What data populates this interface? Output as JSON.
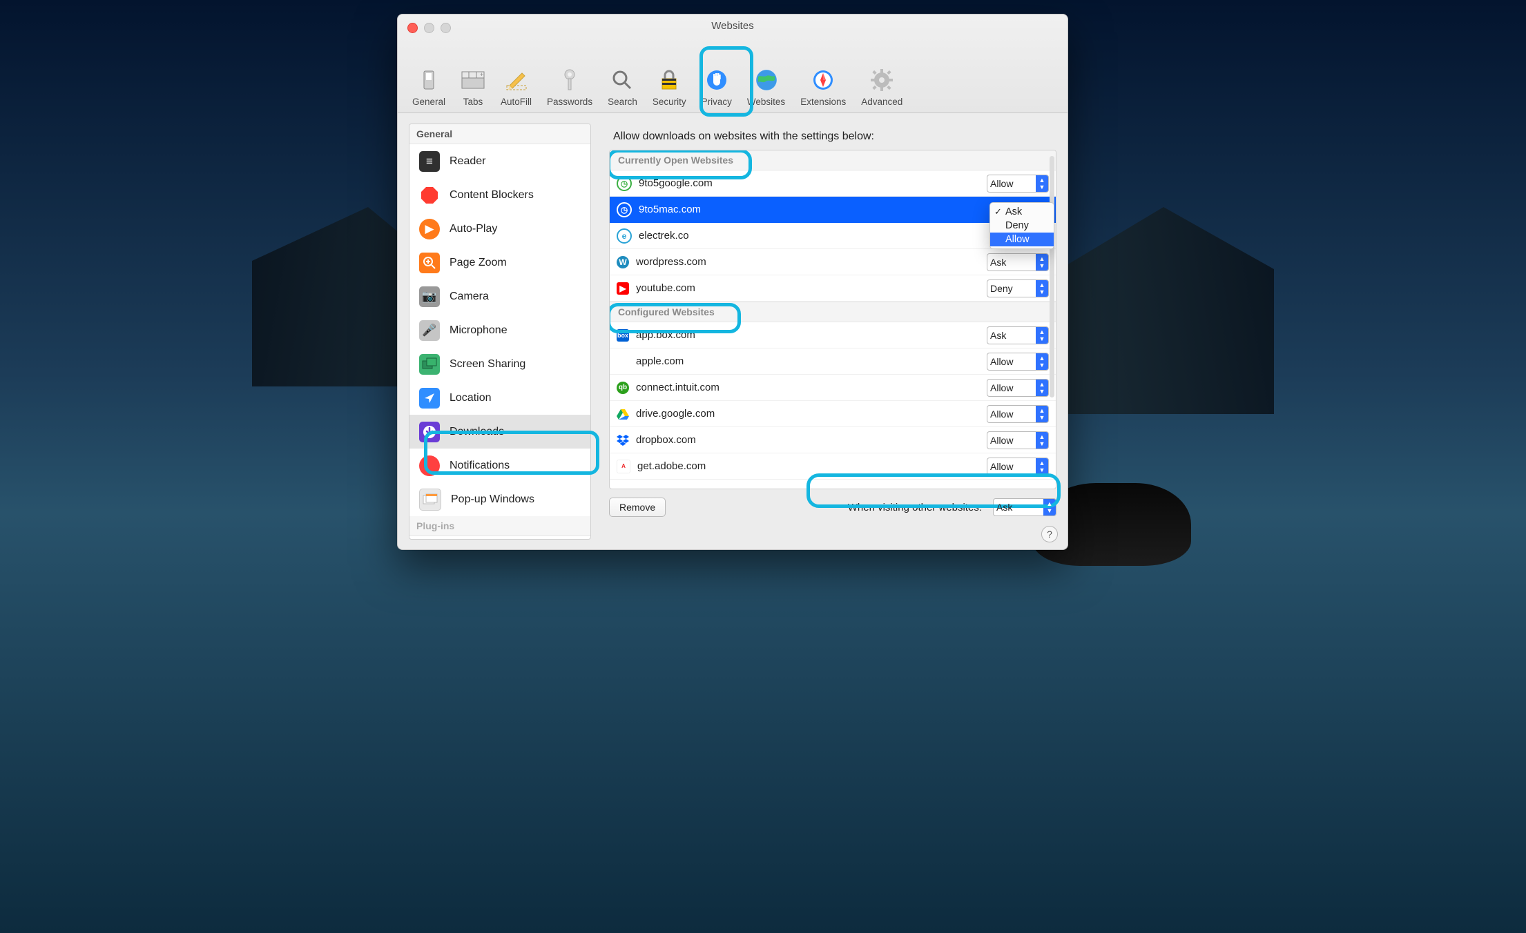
{
  "window": {
    "title": "Websites"
  },
  "toolbar": {
    "items": [
      {
        "label": "General"
      },
      {
        "label": "Tabs"
      },
      {
        "label": "AutoFill"
      },
      {
        "label": "Passwords"
      },
      {
        "label": "Search"
      },
      {
        "label": "Security"
      },
      {
        "label": "Privacy"
      },
      {
        "label": "Websites"
      },
      {
        "label": "Extensions"
      },
      {
        "label": "Advanced"
      }
    ],
    "active_index": 7
  },
  "sidebar": {
    "sections": [
      {
        "title": "General",
        "items": [
          {
            "label": "Reader",
            "icon": "reader"
          },
          {
            "label": "Content Blockers",
            "icon": "block"
          },
          {
            "label": "Auto-Play",
            "icon": "play"
          },
          {
            "label": "Page Zoom",
            "icon": "zoom"
          },
          {
            "label": "Camera",
            "icon": "cam"
          },
          {
            "label": "Microphone",
            "icon": "mic"
          },
          {
            "label": "Screen Sharing",
            "icon": "screen"
          },
          {
            "label": "Location",
            "icon": "loc"
          },
          {
            "label": "Downloads",
            "icon": "dl"
          },
          {
            "label": "Notifications",
            "icon": "notif"
          },
          {
            "label": "Pop-up Windows",
            "icon": "popup"
          }
        ]
      },
      {
        "title": "Plug-ins",
        "items": []
      }
    ],
    "selected_label": "Downloads"
  },
  "main": {
    "heading": "Allow downloads on websites with the settings below:",
    "groups": {
      "open": {
        "title": "Currently Open Websites",
        "rows": [
          {
            "site": "9to5google.com",
            "perm": "Allow",
            "icon": "clock-green"
          },
          {
            "site": "9to5mac.com",
            "perm": "",
            "icon": "clock-white",
            "selected": true
          },
          {
            "site": "electrek.co",
            "perm": "",
            "icon": "e-blue"
          },
          {
            "site": "wordpress.com",
            "perm": "Ask",
            "icon": "wp"
          },
          {
            "site": "youtube.com",
            "perm": "Deny",
            "icon": "yt"
          }
        ]
      },
      "configured": {
        "title": "Configured Websites",
        "rows": [
          {
            "site": "app.box.com",
            "perm": "Ask",
            "icon": "box"
          },
          {
            "site": "apple.com",
            "perm": "Allow",
            "icon": "apple"
          },
          {
            "site": "connect.intuit.com",
            "perm": "Allow",
            "icon": "qb"
          },
          {
            "site": "drive.google.com",
            "perm": "Allow",
            "icon": "drive"
          },
          {
            "site": "dropbox.com",
            "perm": "Allow",
            "icon": "dropbox"
          },
          {
            "site": "get.adobe.com",
            "perm": "Allow",
            "icon": "adobe"
          }
        ]
      }
    },
    "popup": {
      "options": [
        "Ask",
        "Deny",
        "Allow"
      ],
      "checked": "Ask",
      "hover": "Allow"
    },
    "remove_label": "Remove",
    "other_label": "When visiting other websites:",
    "other_value": "Ask"
  },
  "help_tooltip": "?"
}
